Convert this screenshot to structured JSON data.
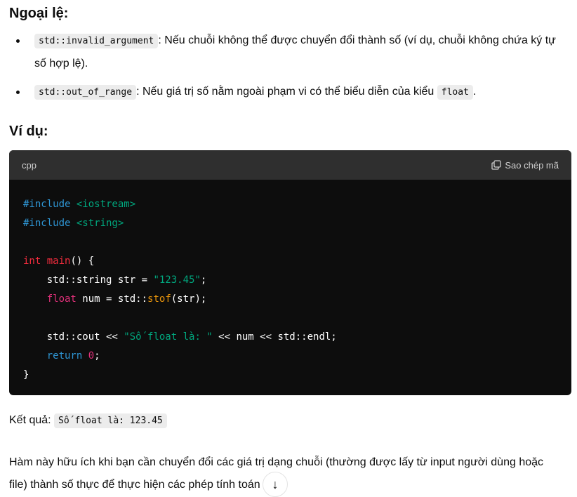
{
  "exceptions_heading": "Ngoại lệ:",
  "exceptions": [
    {
      "code": "std::invalid_argument",
      "text": ": Nếu chuỗi không thể được chuyển đổi thành số (ví dụ, chuỗi không chứa ký tự số hợp lệ)."
    },
    {
      "code": "std::out_of_range",
      "text": ": Nếu giá trị số nằm ngoài phạm vi có thể biểu diễn của kiểu ",
      "code2": "float",
      "tail": "."
    }
  ],
  "example_heading": "Ví dụ:",
  "code_block": {
    "language": "cpp",
    "copy_label": "Sao chép mã",
    "copy_icon": "copy-icon",
    "lines": [
      [
        [
          "#include ",
          "pre"
        ],
        [
          "<iostream>",
          "inc"
        ]
      ],
      [
        [
          "#include ",
          "pre"
        ],
        [
          "<string>",
          "inc"
        ]
      ],
      [],
      [
        [
          "int ",
          "kw"
        ],
        [
          "main",
          "fnname"
        ],
        [
          "() {",
          ""
        ]
      ],
      [
        [
          "    std::string str = ",
          ""
        ],
        [
          "\"123.45\"",
          "str"
        ],
        [
          ";",
          ""
        ]
      ],
      [
        [
          "    ",
          ""
        ],
        [
          "float",
          "type"
        ],
        [
          " num = std::",
          ""
        ],
        [
          "stof",
          "call"
        ],
        [
          "(str);",
          ""
        ]
      ],
      [],
      [
        [
          "    std::cout << ",
          ""
        ],
        [
          "\"Số float là: \"",
          "str"
        ],
        [
          " << num << std::endl;",
          ""
        ]
      ],
      [
        [
          "    ",
          ""
        ],
        [
          "return",
          "ret"
        ],
        [
          " ",
          ""
        ],
        [
          "0",
          "num"
        ],
        [
          ";",
          ""
        ]
      ],
      [
        [
          "}",
          ""
        ]
      ]
    ]
  },
  "result": {
    "label": "Kết quả: ",
    "value": "Số float là: 123.45"
  },
  "paragraph": "Hàm này hữu ích khi bạn cần chuyển đổi các giá trị dạng chuỗi (thường được lấy từ input người dùng hoặc file) thành số thực để thực hiện các phép tính toán học.",
  "scroll_button_icon": "arrow-down-icon",
  "scroll_button_glyph": "↓"
}
